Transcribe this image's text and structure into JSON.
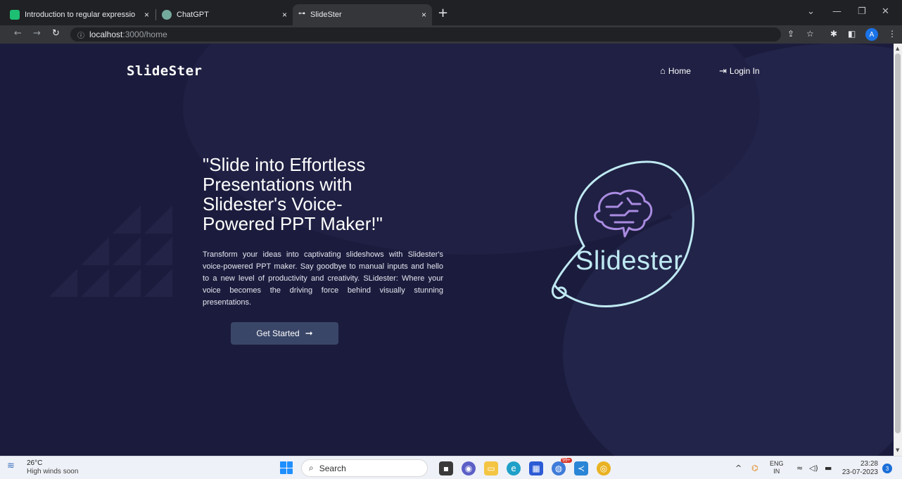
{
  "browser": {
    "tabs": [
      {
        "title": "Introduction to regular expressio",
        "favicon_color": "#1dbf73"
      },
      {
        "title": "ChatGPT",
        "favicon_color": "#74aa9c"
      },
      {
        "title": "SlideSter",
        "favicon_color": "#ffffff",
        "active": true
      }
    ],
    "tab_close": "×",
    "new_tab": "+",
    "url_host": "localhost",
    "url_path": ":3000/home",
    "profile_initial": "A"
  },
  "page": {
    "brand": "SlideSter",
    "nav": [
      {
        "label": "Home",
        "icon": "home-icon"
      },
      {
        "label": "Login In",
        "icon": "login-icon"
      }
    ],
    "headline": "\"Slide into Effortless Presentations with Slidester's Voice-Powered PPT Maker!\"",
    "description": "Transform your ideas into captivating slideshows with Slidester's voice-powered PPT maker. Say goodbye to manual inputs and hello to a new level of productivity and creativity. SLidester: Where your voice becomes the driving force behind visually stunning presentations.",
    "cta_label": "Get Started",
    "logo_text": "Slidester",
    "colors": {
      "background": "#1b1c3d",
      "accent": "#bfe9f2",
      "logo_brain": "#a98be0",
      "button": "#3a4668"
    }
  },
  "taskbar": {
    "weather_temp": "26°C",
    "weather_desc": "High winds soon",
    "search_placeholder": "Search",
    "lang_top": "ENG",
    "lang_bottom": "IN",
    "time": "23:28",
    "date": "23-07-2023",
    "notification_count": "3",
    "chrome_badge": "99+"
  }
}
